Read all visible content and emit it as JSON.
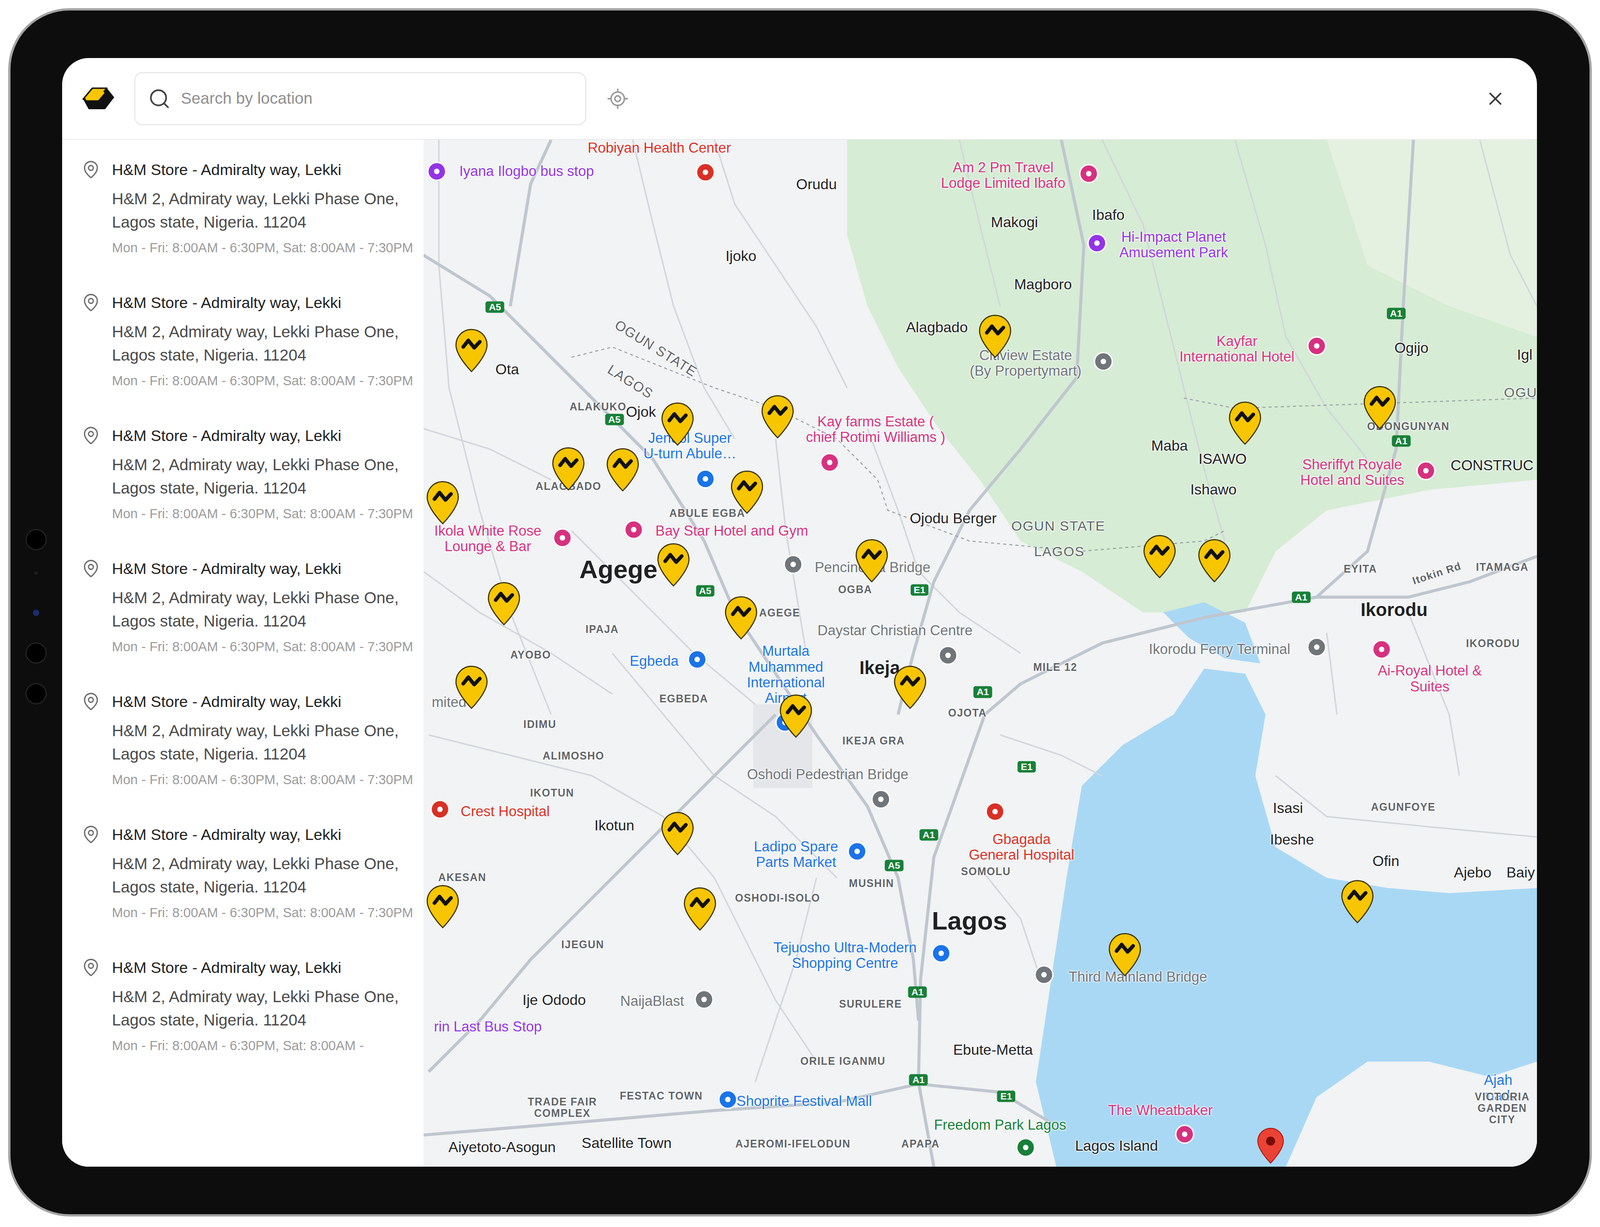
{
  "header": {
    "search": {
      "placeholder": "Search by location"
    }
  },
  "stores": [
    {
      "name": "H&M Store - Admiralty way, Lekki",
      "address": "H&M 2, Admiraty way, Lekki Phase One, Lagos state, Nigeria. 11204",
      "hours": "Mon - Fri: 8:00AM - 6:30PM, Sat: 8:00AM - 7:30PM"
    },
    {
      "name": "H&M Store - Admiralty way, Lekki",
      "address": "H&M 2, Admiraty way, Lekki Phase One, Lagos state, Nigeria. 11204",
      "hours": "Mon - Fri: 8:00AM - 6:30PM, Sat: 8:00AM - 7:30PM"
    },
    {
      "name": "H&M Store - Admiralty way, Lekki",
      "address": "H&M 2, Admiraty way, Lekki Phase One, Lagos state, Nigeria. 11204",
      "hours": "Mon - Fri: 8:00AM - 6:30PM, Sat: 8:00AM - 7:30PM"
    },
    {
      "name": "H&M Store - Admiralty way, Lekki",
      "address": "H&M 2, Admiraty way, Lekki Phase One, Lagos state, Nigeria. 11204",
      "hours": "Mon - Fri: 8:00AM - 6:30PM, Sat: 8:00AM - 7:30PM"
    },
    {
      "name": "H&M Store - Admiralty way, Lekki",
      "address": "H&M 2, Admiraty way, Lekki Phase One, Lagos state, Nigeria. 11204",
      "hours": "Mon - Fri: 8:00AM - 6:30PM, Sat: 8:00AM - 7:30PM"
    },
    {
      "name": "H&M Store - Admiralty way, Lekki",
      "address": "H&M 2, Admiraty way, Lekki Phase One, Lagos state, Nigeria. 11204",
      "hours": "Mon - Fri: 8:00AM - 6:30PM, Sat: 8:00AM - 7:30PM"
    },
    {
      "name": "H&M Store - Admiralty way, Lekki",
      "address": "H&M 2, Admiraty way, Lekki Phase One, Lagos state, Nigeria. 11204",
      "hours": "Mon - Fri: 8:00AM - 6:30PM, Sat: 8:00AM -"
    }
  ],
  "map": {
    "labels": [
      {
        "text": "Robiyan Health Center",
        "kind": "poi",
        "color": "#d93025"
      },
      {
        "text": "Iyana Ilogbo bus stop",
        "kind": "poi",
        "color": "#9334e6"
      },
      {
        "text": "Orudu",
        "kind": "town"
      },
      {
        "text": "Am 2 Pm Travel\nLodge Limited Ibafo",
        "kind": "poi",
        "color": "#d6317f"
      },
      {
        "text": "Makogi",
        "kind": "town"
      },
      {
        "text": "Ibafo",
        "kind": "town"
      },
      {
        "text": "Hi-Impact Planet\nAmusement Park",
        "kind": "poi",
        "color": "#9334e6"
      },
      {
        "text": "Ijoko",
        "kind": "town"
      },
      {
        "text": "Magboro",
        "kind": "town"
      },
      {
        "text": "Alagbado",
        "kind": "town"
      },
      {
        "text": "Citiview Estate\n(By Propertymart)",
        "kind": "poi",
        "color": "#70757a"
      },
      {
        "text": "Kayfar\nInternational Hotel",
        "kind": "poi",
        "color": "#d6317f"
      },
      {
        "text": "Ogijo",
        "kind": "town"
      },
      {
        "text": "Igl",
        "kind": "town"
      },
      {
        "text": "Ota",
        "kind": "town"
      },
      {
        "text": "OGUN STATE",
        "kind": "state"
      },
      {
        "text": "LAGOS",
        "kind": "state"
      },
      {
        "text": "ALAKUKO",
        "kind": "district"
      },
      {
        "text": "Ojok",
        "kind": "town"
      },
      {
        "text": "Kay farms Estate (\nchief Rotimi Williams )",
        "kind": "poi",
        "color": "#d6317f"
      },
      {
        "text": "Jendol Super\nU-turn Abule…",
        "kind": "poi",
        "color": "#1a73e8"
      },
      {
        "text": "OGUN STATE",
        "kind": "state"
      },
      {
        "text": "LAGOS",
        "kind": "state"
      },
      {
        "text": "Maba",
        "kind": "town"
      },
      {
        "text": "ISAWO",
        "kind": "town"
      },
      {
        "text": "Ishawo",
        "kind": "town"
      },
      {
        "text": "ODONGUNYAN",
        "kind": "district"
      },
      {
        "text": "OGU",
        "kind": "state"
      },
      {
        "text": "Sheriffyt Royale\nHotel and Suites",
        "kind": "poi",
        "color": "#d6317f"
      },
      {
        "text": "CONSTRUC",
        "kind": "town"
      },
      {
        "text": "ALAGBADO",
        "kind": "district"
      },
      {
        "text": "ABULE EGBA",
        "kind": "district"
      },
      {
        "text": "Ikola White Rose\nLounge & Bar",
        "kind": "poi",
        "color": "#d6317f"
      },
      {
        "text": "Bay Star Hotel and Gym",
        "kind": "poi",
        "color": "#d6317f"
      },
      {
        "text": "Ojodu Berger",
        "kind": "town"
      },
      {
        "text": "Agege",
        "kind": "city"
      },
      {
        "text": "Pencinema Bridge",
        "kind": "poi",
        "color": "#70757a"
      },
      {
        "text": "OGBA",
        "kind": "district"
      },
      {
        "text": "EYITA",
        "kind": "district"
      },
      {
        "text": "Itokin Rd",
        "kind": "district"
      },
      {
        "text": "ITAMAGA",
        "kind": "district"
      },
      {
        "text": "Ikorodu",
        "kind": "city2"
      },
      {
        "text": "IPAJA",
        "kind": "district"
      },
      {
        "text": "AGEGE",
        "kind": "district"
      },
      {
        "text": "Daystar Christian Centre",
        "kind": "poi",
        "color": "#70757a"
      },
      {
        "text": "AYOBO",
        "kind": "district"
      },
      {
        "text": "Ikorodu Ferry Terminal",
        "kind": "poi",
        "color": "#70757a"
      },
      {
        "text": "IKORODU",
        "kind": "district"
      },
      {
        "text": "Egbeda",
        "kind": "poi",
        "color": "#1a73e8"
      },
      {
        "text": "Murtala\nMuhammed\nInternational\nAirport",
        "kind": "poi",
        "color": "#1a73e8"
      },
      {
        "text": "Ikeja",
        "kind": "city2"
      },
      {
        "text": "MILE 12",
        "kind": "district"
      },
      {
        "text": "Ai-Royal Hotel & Suites",
        "kind": "poi",
        "color": "#d6317f"
      },
      {
        "text": "EGBEDA",
        "kind": "district"
      },
      {
        "text": "OJOTA",
        "kind": "district"
      },
      {
        "text": "mited",
        "kind": "poi",
        "color": "#70757a"
      },
      {
        "text": "IDIMU",
        "kind": "district"
      },
      {
        "text": "IKEJA GRA",
        "kind": "district"
      },
      {
        "text": "ALIMOSHO",
        "kind": "district"
      },
      {
        "text": "Oshodi Pedestrian Bridge",
        "kind": "poi",
        "color": "#70757a"
      },
      {
        "text": "IKOTUN",
        "kind": "district"
      },
      {
        "text": "Crest Hospital",
        "kind": "poi",
        "color": "#d93025"
      },
      {
        "text": "Isasi",
        "kind": "town"
      },
      {
        "text": "AGUNFOYE",
        "kind": "district"
      },
      {
        "text": "Ikotun",
        "kind": "town"
      },
      {
        "text": "Gbagada\nGeneral Hospital",
        "kind": "poi",
        "color": "#d93025"
      },
      {
        "text": "Ibeshe",
        "kind": "town"
      },
      {
        "text": "Ladipo Spare\nParts Market",
        "kind": "poi",
        "color": "#1a73e8"
      },
      {
        "text": "Ofin",
        "kind": "town"
      },
      {
        "text": "SOMOLU",
        "kind": "district"
      },
      {
        "text": "Ajebo",
        "kind": "town"
      },
      {
        "text": "Baiy",
        "kind": "town"
      },
      {
        "text": "AKESAN",
        "kind": "district"
      },
      {
        "text": "MUSHIN",
        "kind": "district"
      },
      {
        "text": "OSHODI-ISOLO",
        "kind": "district"
      },
      {
        "text": "Lagos",
        "kind": "city"
      },
      {
        "text": "IJEGUN",
        "kind": "district"
      },
      {
        "text": "Tejuosho Ultra-Modern\nShopping Centre",
        "kind": "poi",
        "color": "#1a73e8"
      },
      {
        "text": "Third Mainland Bridge",
        "kind": "poi",
        "color": "#70757a"
      },
      {
        "text": "Ije Ododo",
        "kind": "town"
      },
      {
        "text": "NaijaBlast",
        "kind": "poi",
        "color": "#70757a"
      },
      {
        "text": "SURULERE",
        "kind": "district"
      },
      {
        "text": "rin Last Bus Stop",
        "kind": "poi",
        "color": "#9334e6"
      },
      {
        "text": "Ebute-Metta",
        "kind": "town"
      },
      {
        "text": "ORILE IGANMU",
        "kind": "district"
      },
      {
        "text": "Ajah mark",
        "kind": "poi",
        "color": "#1a73e8"
      },
      {
        "text": "FESTAC TOWN",
        "kind": "district"
      },
      {
        "text": "Shoprite Festival Mall",
        "kind": "poi",
        "color": "#1a73e8"
      },
      {
        "text": "TRADE FAIR\nCOMPLEX",
        "kind": "district"
      },
      {
        "text": "The Wheatbaker",
        "kind": "poi",
        "color": "#d6317f"
      },
      {
        "text": "VICTORIA\nGARDEN CITY",
        "kind": "district"
      },
      {
        "text": "Freedom Park Lagos",
        "kind": "poi",
        "color": "#188038"
      },
      {
        "text": "Lagos Island",
        "kind": "town"
      },
      {
        "text": "Aiyetoto-Asogun",
        "kind": "town"
      },
      {
        "text": "Satellite Town",
        "kind": "town"
      },
      {
        "text": "AJEROMI-IFELODUN",
        "kind": "district"
      },
      {
        "text": "APAPA",
        "kind": "district"
      },
      {
        "text": "A5",
        "kind": "shield"
      },
      {
        "text": "A5",
        "kind": "shield"
      },
      {
        "text": "A5",
        "kind": "shield"
      },
      {
        "text": "A5",
        "kind": "shield"
      },
      {
        "text": "A1",
        "kind": "shield"
      },
      {
        "text": "A1",
        "kind": "shield"
      },
      {
        "text": "A1",
        "kind": "shield"
      },
      {
        "text": "A1",
        "kind": "shield"
      },
      {
        "text": "A1",
        "kind": "shield"
      },
      {
        "text": "A1",
        "kind": "shield"
      },
      {
        "text": "A1",
        "kind": "shield"
      },
      {
        "text": "E1",
        "kind": "shield"
      },
      {
        "text": "E1",
        "kind": "shield"
      },
      {
        "text": "E1",
        "kind": "shield"
      }
    ],
    "markers": [
      {
        "kind": "store"
      },
      {
        "kind": "store"
      },
      {
        "kind": "store"
      },
      {
        "kind": "store"
      },
      {
        "kind": "store"
      },
      {
        "kind": "store"
      },
      {
        "kind": "store"
      },
      {
        "kind": "store"
      },
      {
        "kind": "store"
      },
      {
        "kind": "store"
      },
      {
        "kind": "store"
      },
      {
        "kind": "store"
      },
      {
        "kind": "store"
      },
      {
        "kind": "store"
      },
      {
        "kind": "store"
      },
      {
        "kind": "store"
      },
      {
        "kind": "store"
      },
      {
        "kind": "store"
      },
      {
        "kind": "store"
      },
      {
        "kind": "store"
      },
      {
        "kind": "store"
      },
      {
        "kind": "store"
      },
      {
        "kind": "store"
      },
      {
        "kind": "store"
      },
      {
        "kind": "location"
      }
    ]
  }
}
